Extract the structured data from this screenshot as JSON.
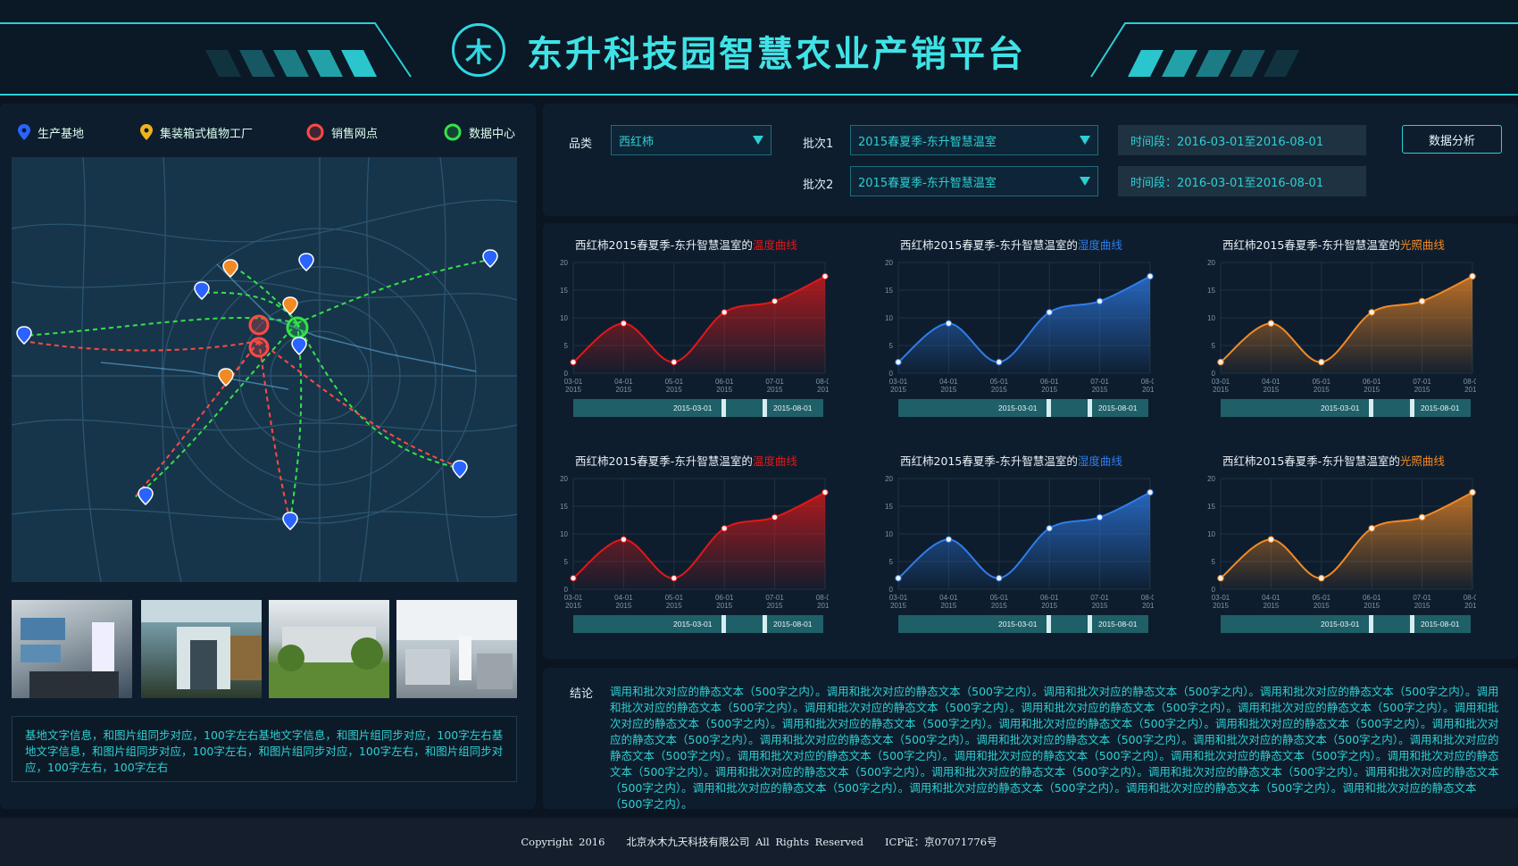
{
  "header": {
    "title": "东升科技园智慧农业产销平台"
  },
  "legend": [
    {
      "label": "生产基地",
      "icon": "blue-pin-icon",
      "color": "#2a63ff"
    },
    {
      "label": "集装箱式植物工厂",
      "icon": "yellow-pin-icon",
      "color": "#f2b21c"
    },
    {
      "label": "销售网点",
      "icon": "red-ring-icon",
      "color": "#ff4a44"
    },
    {
      "label": "数据中心",
      "icon": "green-ring-icon",
      "color": "#35e24a"
    }
  ],
  "base_text": "基地文字信息，和图片组同步对应，100字左右基地文字信息，和图片组同步对应，100字左右基地文字信息，和图片组同步对应，100字左右，和图片组同步对应，100字左右，和图片组同步对应，100字左右，100字左右",
  "filter": {
    "category_label": "品类",
    "category_value": "西红柿",
    "batch1_label": "批次1",
    "batch1_value": "2015春夏季-东升智慧温室",
    "batch2_label": "批次2",
    "batch2_value": "2015春夏季-东升智慧温室",
    "time1": "时间段：2016-03-01至2016-08-01",
    "time2": "时间段：2016-03-01至2016-08-01",
    "analyze_button": "数据分析"
  },
  "chart_data": [
    {
      "type": "area",
      "title_prefix": "西红柿2015春夏季-东升智慧温室的",
      "title_highlight": "温度曲线",
      "color": "#e21818",
      "x": [
        "03-01 2015",
        "04-01 2015",
        "05-01 2015",
        "06-01 2015",
        "07-01 2015",
        "08-01 2015"
      ],
      "values": [
        2,
        9,
        2,
        11,
        13,
        17.5
      ],
      "ylim": [
        0,
        20
      ],
      "range_start": "2015-03-01",
      "range_end": "2015-08-01"
    },
    {
      "type": "area",
      "title_prefix": "西红柿2015春夏季-东升智慧温室的",
      "title_highlight": "湿度曲线",
      "color": "#2f7dea",
      "x": [
        "03-01 2015",
        "04-01 2015",
        "05-01 2015",
        "06-01 2015",
        "07-01 2015",
        "08-01 2015"
      ],
      "values": [
        2,
        9,
        2,
        11,
        13,
        17.5
      ],
      "ylim": [
        0,
        20
      ],
      "range_start": "2015-03-01",
      "range_end": "2015-08-01"
    },
    {
      "type": "area",
      "title_prefix": "西红柿2015春夏季-东升智慧温室的",
      "title_highlight": "光照曲线",
      "color": "#f28a24",
      "x": [
        "03-01 2015",
        "04-01 2015",
        "05-01 2015",
        "06-01 2015",
        "07-01 2015",
        "08-01 2015"
      ],
      "values": [
        2,
        9,
        2,
        11,
        13,
        17.5
      ],
      "ylim": [
        0,
        20
      ],
      "range_start": "2015-03-01",
      "range_end": "2015-08-01"
    },
    {
      "type": "area",
      "title_prefix": "西红柿2015春夏季-东升智慧温室的",
      "title_highlight": "温度曲线",
      "color": "#e21818",
      "x": [
        "03-01 2015",
        "04-01 2015",
        "05-01 2015",
        "06-01 2015",
        "07-01 2015",
        "08-01 2015"
      ],
      "values": [
        2,
        9,
        2,
        11,
        13,
        17.5
      ],
      "ylim": [
        0,
        20
      ],
      "range_start": "2015-03-01",
      "range_end": "2015-08-01"
    },
    {
      "type": "area",
      "title_prefix": "西红柿2015春夏季-东升智慧温室的",
      "title_highlight": "湿度曲线",
      "color": "#2f7dea",
      "x": [
        "03-01 2015",
        "04-01 2015",
        "05-01 2015",
        "06-01 2015",
        "07-01 2015",
        "08-01 2015"
      ],
      "values": [
        2,
        9,
        2,
        11,
        13,
        17.5
      ],
      "ylim": [
        0,
        20
      ],
      "range_start": "2015-03-01",
      "range_end": "2015-08-01"
    },
    {
      "type": "area",
      "title_prefix": "西红柿2015春夏季-东升智慧温室的",
      "title_highlight": "光照曲线",
      "color": "#f28a24",
      "x": [
        "03-01 2015",
        "04-01 2015",
        "05-01 2015",
        "06-01 2015",
        "07-01 2015",
        "08-01 2015"
      ],
      "values": [
        2,
        9,
        2,
        11,
        13,
        17.5
      ],
      "ylim": [
        0,
        20
      ],
      "range_start": "2015-03-01",
      "range_end": "2015-08-01"
    }
  ],
  "conclusion": {
    "label": "结论",
    "text": "调用和批次对应的静态文本（500字之内）。调用和批次对应的静态文本（500字之内）。调用和批次对应的静态文本（500字之内）。调用和批次对应的静态文本（500字之内）。调用和批次对应的静态文本（500字之内）。调用和批次对应的静态文本（500字之内）。调用和批次对应的静态文本（500字之内）。调用和批次对应的静态文本（500字之内）。调用和批次对应的静态文本（500字之内）。调用和批次对应的静态文本（500字之内）。调用和批次对应的静态文本（500字之内）。调用和批次对应的静态文本（500字之内）。调用和批次对应的静态文本（500字之内）。调用和批次对应的静态文本（500字之内）。调用和批次对应的静态文本（500字之内）。调用和批次对应的静态文本（500字之内）。调用和批次对应的静态文本（500字之内）。调用和批次对应的静态文本（500字之内）。调用和批次对应的静态文本（500字之内）。调用和批次对应的静态文本（500字之内）。调用和批次对应的静态文本（500字之内）。调用和批次对应的静态文本（500字之内）。调用和批次对应的静态文本（500字之内）。调用和批次对应的静态文本（500字之内）。调用和批次对应的静态文本（500字之内）。调用和批次对应的静态文本（500字之内）。调用和批次对应的静态文本（500字之内）。调用和批次对应的静态文本（500字之内）。调用和批次对应的静态文本（500字之内）。"
  },
  "footer": {
    "copyright": "Copyright 2016",
    "company": "北京水木九天科技有限公司 All Rights Reserved",
    "icp": "ICP证：京07071776号"
  }
}
